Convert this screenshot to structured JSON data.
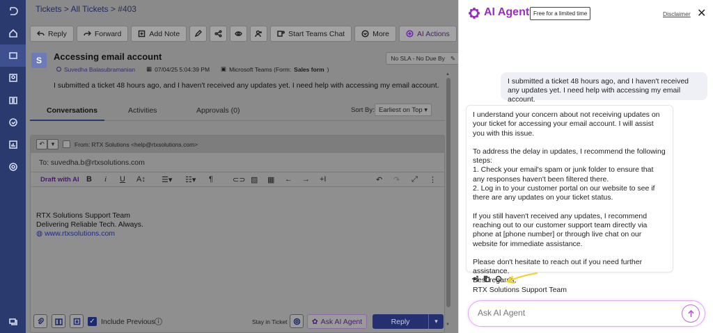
{
  "breadcrumb": {
    "tickets": "Tickets",
    "sep1": " > ",
    "all": "All Tickets",
    "sep2": " > ",
    "id": "#403"
  },
  "toolbar": {
    "reply": "Reply",
    "forward": "Forward",
    "add_note": "Add Note",
    "teams": "Start Teams Chat",
    "more": "More",
    "ai_actions": "AI Actions"
  },
  "ticket": {
    "avatar_letter": "S",
    "subject": "Accessing email account",
    "requester": "Suvedha Balasubramanian",
    "date": "07/04/25 5:04:39 PM",
    "source": "Microsoft Teams (Form: ",
    "source_form": "Sales form",
    "source_end": ")",
    "sla": "No SLA - No Due By",
    "description": "I submitted a ticket 48 hours ago, and I haven't received any updates yet. I need help with accessing my email account."
  },
  "tabs": {
    "conversations": "Conversations",
    "activities": "Activities",
    "approvals": "Approvals (0)",
    "sort_label": "Sort By:",
    "sort_value": "Earliest on Top"
  },
  "editor": {
    "from": "From:  RTX Solutions <help@rtxsolutions.com>",
    "to": "To: suvedha.b@rtxsolutions.com",
    "draft_ai": "Draft with AI",
    "sig1": "RTX Solutions Support Team",
    "sig2": "Delivering Reliable Tech. Always.",
    "sig3": "www.rtxsolutions.com",
    "include_previous": "Include Previous",
    "stay": "Stay in Ticket",
    "ask_ai": "Ask AI Agent",
    "reply": "Reply"
  },
  "panel": {
    "title": "AI Agent",
    "badge": "Free for a limited time",
    "disclaimer": "Disclaimer",
    "user_msg": "I submitted a ticket 48 hours ago, and I haven't received any updates yet. I need help with accessing my email account.",
    "ai_p1": "I understand your concern about not receiving updates on your ticket for accessing your email account. I will assist you with this issue.",
    "ai_p2a": "To address the delay in updates, I recommend the following steps:",
    "ai_p2b": "1. Check your email's spam or junk folder to ensure that any responses haven't been filtered there.",
    "ai_p2c": "2. Log in to your customer portal on our website to see if there are any updates on your ticket status.",
    "ai_p3": "If you still haven't received any updates, I recommend reaching out to our customer support team directly via phone at [phone number] or through live chat on our website for immediate assistance.",
    "ai_p4a": "Please don't hesitate to reach out if you need further assistance.",
    "ai_p4b": "Best regards,",
    "ai_p4c": "RTX Solutions Support Team",
    "placeholder": "Ask AI Agent"
  },
  "colors": {
    "nav": "#2b3a6e",
    "accent": "#9a2cc6",
    "reply": "#243070"
  }
}
